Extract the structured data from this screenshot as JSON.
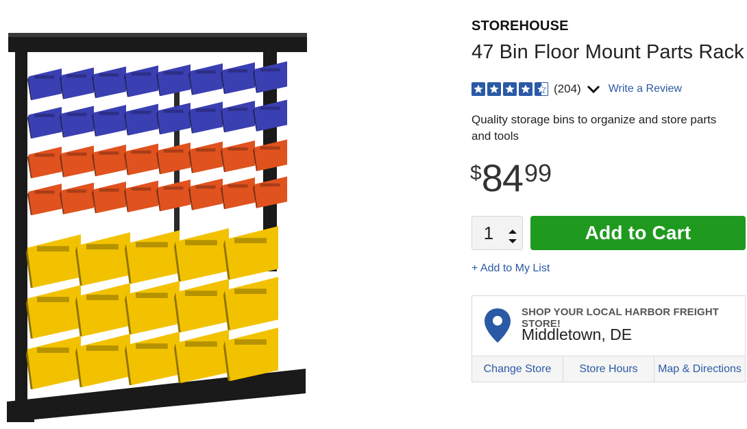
{
  "product": {
    "brand": "STOREHOUSE",
    "title": "47 Bin Floor Mount Parts Rack",
    "rating": 4.5,
    "review_count": "(204)",
    "write_review": "Write a Review",
    "description": "Quality storage bins to organize and store parts and tools",
    "price": {
      "currency": "$",
      "dollars": "84",
      "cents": "99"
    }
  },
  "purchase": {
    "quantity": "1",
    "add_to_cart": "Add to Cart",
    "add_to_list": "+ Add to My List"
  },
  "store": {
    "heading": "SHOP YOUR LOCAL HARBOR FREIGHT STORE!",
    "name": "Middletown, DE",
    "links": [
      "Change Store",
      "Store Hours",
      "Map & Directions"
    ]
  },
  "colors": {
    "link": "#2a5aa5",
    "cart_button": "#1f9a1f",
    "star": "#2a5aa5",
    "bin_blue": "#3a3fb2",
    "bin_orange": "#e0521e",
    "bin_yellow": "#f2c200",
    "rack": "#1a1a1a"
  },
  "icons": [
    "star-icon",
    "chevron-down-icon",
    "arrow-up-icon",
    "arrow-down-icon",
    "map-pin-icon"
  ]
}
